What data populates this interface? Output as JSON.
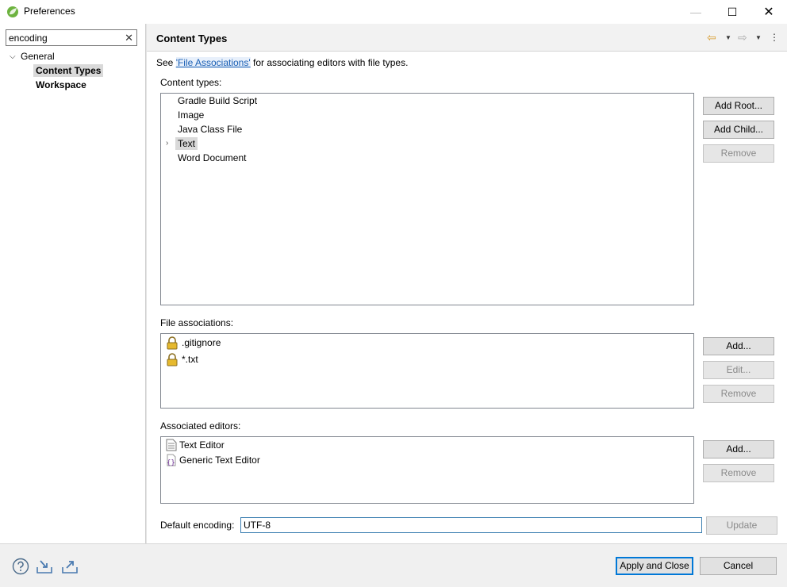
{
  "window": {
    "title": "Preferences",
    "minimize_glyph": "—",
    "maximize_glyph": "☐",
    "close_glyph": "✕"
  },
  "filter": {
    "value": "encoding",
    "clear_glyph": "✕"
  },
  "tree": {
    "root_label": "General",
    "children": [
      {
        "label": "Content Types",
        "selected": true
      },
      {
        "label": "Workspace",
        "selected": false
      }
    ]
  },
  "page": {
    "title": "Content Types",
    "see_prefix": "See ",
    "see_link": "'File Associations'",
    "see_suffix": " for associating editors with file types.",
    "content_types_label": "Content types:",
    "content_types": [
      {
        "label": "Gradle Build Script",
        "expandable": false,
        "selected": false
      },
      {
        "label": "Image",
        "expandable": false,
        "selected": false
      },
      {
        "label": "Java Class File",
        "expandable": false,
        "selected": false
      },
      {
        "label": "Text",
        "expandable": true,
        "selected": true
      },
      {
        "label": "Word Document",
        "expandable": false,
        "selected": false
      }
    ],
    "content_buttons": {
      "add_root": "Add Root...",
      "add_child": "Add Child...",
      "remove": "Remove"
    },
    "file_assoc_label": "File associations:",
    "file_associations": [
      {
        "label": ".gitignore",
        "icon": "lock-icon"
      },
      {
        "label": "*.txt",
        "icon": "lock-icon"
      }
    ],
    "file_assoc_buttons": {
      "add": "Add...",
      "edit": "Edit...",
      "remove": "Remove"
    },
    "editors_label": "Associated editors:",
    "editors": [
      {
        "label": "Text Editor",
        "icon": "text-file-icon"
      },
      {
        "label": "Generic Text Editor",
        "icon": "generic-editor-icon"
      }
    ],
    "editor_buttons": {
      "add": "Add...",
      "remove": "Remove"
    },
    "encoding_label": "Default encoding:",
    "encoding_value": "UTF-8",
    "update_label": "Update"
  },
  "bottom": {
    "apply_close": "Apply and Close",
    "cancel": "Cancel"
  },
  "colors": {
    "accent": "#0078d7",
    "link": "#1a5fb4",
    "back_arrow": "#d89b2b"
  }
}
